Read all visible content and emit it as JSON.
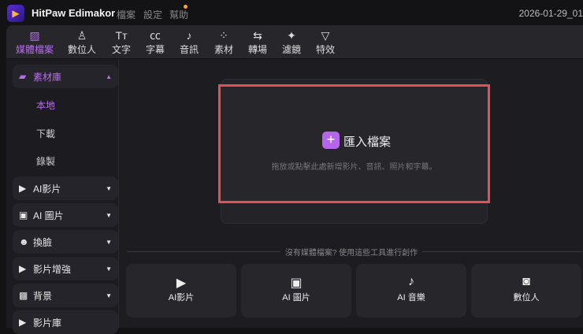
{
  "app": {
    "name": "HitPaw Edimakor",
    "menus": [
      "檔案",
      "設定",
      "幫助"
    ],
    "date": "2026-01-29_01",
    "accent": "#b565ec"
  },
  "toolbar": {
    "tabs": [
      {
        "label": "媒體檔案",
        "icon": "media-icon"
      },
      {
        "label": "數位人",
        "icon": "avatar-icon"
      },
      {
        "label": "文字",
        "icon": "text-icon"
      },
      {
        "label": "字幕",
        "icon": "subtitle-icon"
      },
      {
        "label": "音訊",
        "icon": "music-icon"
      },
      {
        "label": "素材",
        "icon": "assets-icon"
      },
      {
        "label": "轉場",
        "icon": "transition-icon"
      },
      {
        "label": "濾鏡",
        "icon": "filter-icon"
      },
      {
        "label": "特效",
        "icon": "effect-icon"
      }
    ]
  },
  "sidebar": {
    "library": "素材庫",
    "subitems": [
      "本地",
      "下載",
      "錄製"
    ],
    "items": [
      "AI影片",
      "AI 圖片",
      "換臉",
      "影片增強",
      "背景",
      "影片庫"
    ]
  },
  "main": {
    "import_label": "匯入檔案",
    "hint": "拖放或點擊此處新增影片、音訊、照片和字幕。",
    "divider": "沒有媒體檔案? 使用這些工具進行創作",
    "cards": [
      "AI影片",
      "AI 圖片",
      "AI 音樂",
      "數位人"
    ]
  }
}
